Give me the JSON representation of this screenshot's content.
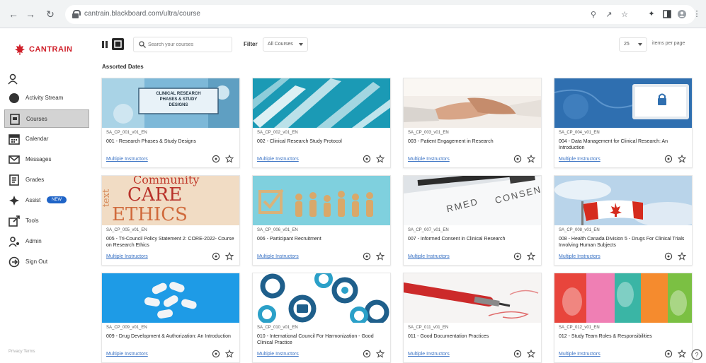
{
  "browser": {
    "url": "cantrain.blackboard.com/ultra/course",
    "buttons": [
      "back-icon",
      "forward-icon",
      "reload-icon"
    ],
    "extension_icons": [
      "zoom-icon",
      "share-icon",
      "bookmark-star-icon",
      "extensions-puzzle-icon",
      "sidebar-panel-icon",
      "profile-icon",
      "kebab-menu-icon"
    ]
  },
  "sidebar": {
    "logo_text": "CANTRAIN",
    "items": [
      {
        "label": "Activity Stream",
        "icon": "activity-stream-icon",
        "active": false
      },
      {
        "label": "Courses",
        "icon": "courses-icon",
        "active": true
      },
      {
        "label": "Calendar",
        "icon": "calendar-icon",
        "active": false
      },
      {
        "label": "Messages",
        "icon": "messages-icon",
        "active": false
      },
      {
        "label": "Grades",
        "icon": "grades-icon",
        "active": false
      },
      {
        "label": "Assist",
        "icon": "assist-icon",
        "active": false,
        "badge": "NEW"
      },
      {
        "label": "Tools",
        "icon": "tools-icon",
        "active": false
      },
      {
        "label": "Admin",
        "icon": "admin-icon",
        "active": false
      },
      {
        "label": "Sign Out",
        "icon": "sign-out-icon",
        "active": false
      }
    ],
    "footer": "Privacy Terms"
  },
  "toolbar": {
    "search_placeholder": "Search your courses",
    "filter_label": "Filter",
    "filter_value": "All Courses",
    "per_page_value": "25",
    "per_page_label": "items per page"
  },
  "section_title": "Assorted Dates",
  "courses": [
    {
      "code": "SA_CP_001_v01_EN",
      "title": "001 - Research Phases & Study Designs",
      "instructors": "Multiple Instructors",
      "image": "clinical-research-phases",
      "image_text": [
        "CLINICAL RESEARCH",
        "PHASES & STUDY",
        "DESIGNS"
      ]
    },
    {
      "code": "SA_CP_002_v01_EN",
      "title": "002 - Clinical Research Study Protocol",
      "instructors": "Multiple Instructors",
      "image": "blue-brush-strokes"
    },
    {
      "code": "SA_CP_003_v01_EN",
      "title": "003 - Patient Engagement in Research",
      "instructors": "Multiple Instructors",
      "image": "handshake"
    },
    {
      "code": "SA_CP_004_v01_EN",
      "title": "004 - Data Management for Clinical Research: An Introduction",
      "instructors": "Multiple Instructors",
      "image": "data-lock-screen"
    },
    {
      "code": "SA_CP_005_v01_EN",
      "title": "005 - Tri-Council Policy Statement 2: CORE-2022- Course on Research Ethics",
      "instructors": "Multiple Instructors",
      "image": "community-care-ethics",
      "image_text": [
        "Community",
        "CARE",
        "ETHICS",
        "text"
      ]
    },
    {
      "code": "SA_CP_006_v01_EN",
      "title": "006 - Participant Recruitment",
      "instructors": "Multiple Instructors",
      "image": "wooden-figures-checkbox"
    },
    {
      "code": "SA_CP_007_v01_EN",
      "title": "007 - Informed Consent in Clinical Research",
      "instructors": "Multiple Instructors",
      "image": "informed-consent-clipboard",
      "image_text": [
        "RMED",
        "CONSENT"
      ]
    },
    {
      "code": "SA_CP_008_v01_EN",
      "title": "008 - Health Canada Division 5 - Drugs For Clinical Trials Involving Human Subjects",
      "instructors": "Multiple Instructors",
      "image": "canada-flag"
    },
    {
      "code": "SA_CP_009_v01_EN",
      "title": "009 - Drug Development & Authorization: An Introduction",
      "instructors": "Multiple Instructors",
      "image": "pills-on-blue"
    },
    {
      "code": "SA_CP_010_v01_EN",
      "title": "010 - International Council For Harmonization - Good Clinical Practice",
      "instructors": "Multiple Instructors",
      "image": "gears-icons"
    },
    {
      "code": "SA_CP_011_v01_EN",
      "title": "011 - Good Documentation Practices",
      "instructors": "Multiple Instructors",
      "image": "red-pen"
    },
    {
      "code": "SA_CP_012_v01_EN",
      "title": "012 - Study Team Roles & Responsibilities",
      "instructors": "Multiple Instructors",
      "image": "colorful-hands"
    }
  ],
  "colors": {
    "brand_red": "#d0202a",
    "link_blue": "#3b73c4",
    "active_bg": "#d3d3d3",
    "badge_blue": "#1f64c7"
  }
}
